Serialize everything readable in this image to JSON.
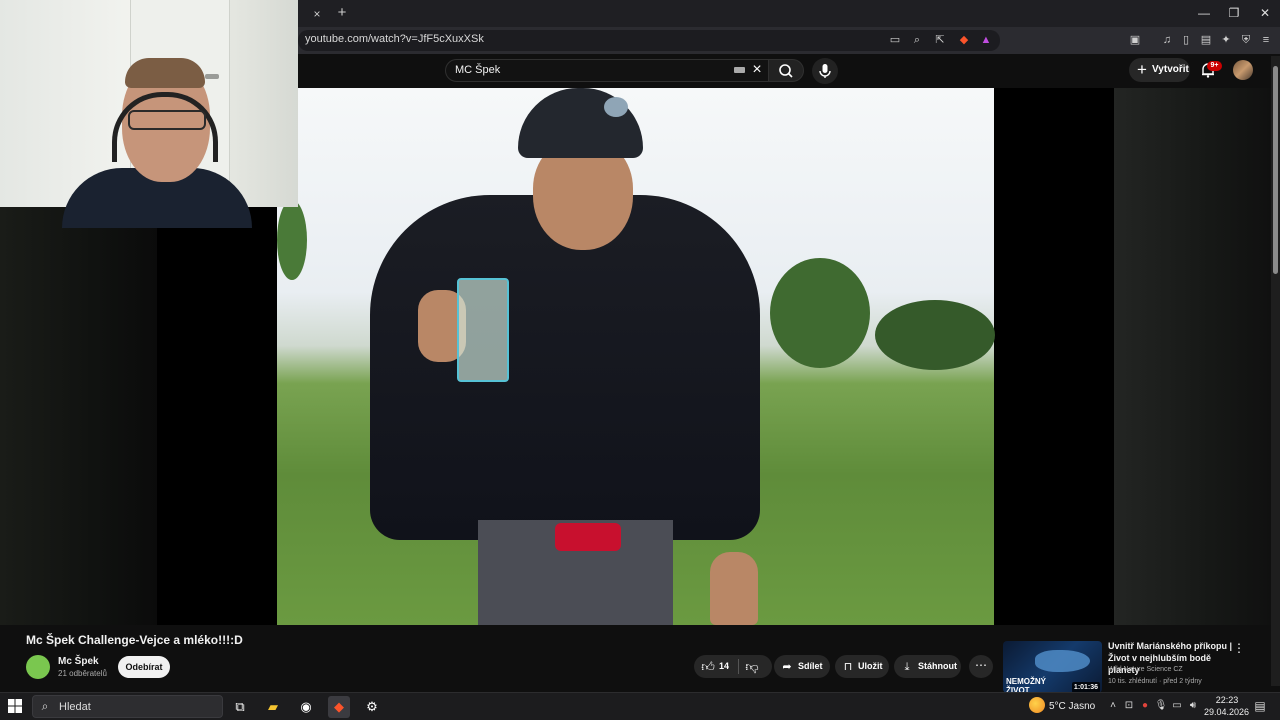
{
  "browser": {
    "url": "youtube.com/watch?v=JfF5cXuxXSk",
    "tab_close": "×",
    "new_tab": "+",
    "window_controls": {
      "minimize": "—",
      "restore": "❐",
      "close": "✕"
    }
  },
  "youtube_header": {
    "search_value": "MC Špek",
    "create_label": "Vytvořit",
    "notification_badge": "9+"
  },
  "video": {
    "title": "Mc Špek Challenge-Vejce a mléko!!!:D",
    "channel_name": "Mc Špek",
    "subscribers": "21 odběratelů",
    "subscribe_label": "Odebírat",
    "like_count": "14",
    "share_label": "Sdílet",
    "save_label": "Uložit",
    "download_label": "Stáhnout"
  },
  "recommendation": {
    "title": "Uvnitř Mariánského příkopu | Život v nejhlubším bodě planety",
    "channel": "Wild Nature Science CZ",
    "meta": "10 tis. zhlédnutí · před 2 týdny",
    "duration": "1:01:36",
    "thumb_text_line1": "NEMOŽNÝ",
    "thumb_text_line2": "ŽIVOT"
  },
  "taskbar": {
    "search_placeholder": "Hledat",
    "weather": "5°C  Jasno",
    "time": "22:23",
    "date": "29.04.2026"
  },
  "icons": {
    "search": "search-icon",
    "mic": "microphone-icon",
    "bell": "bell-icon",
    "like": "thumbs-up-icon",
    "dislike": "thumbs-down-icon",
    "share": "share-icon",
    "save": "bookmark-icon",
    "download": "download-icon"
  },
  "colors": {
    "background": "#0f0f0f",
    "accent_red": "#cc0000",
    "channel_avatar": "#7ac74f"
  }
}
